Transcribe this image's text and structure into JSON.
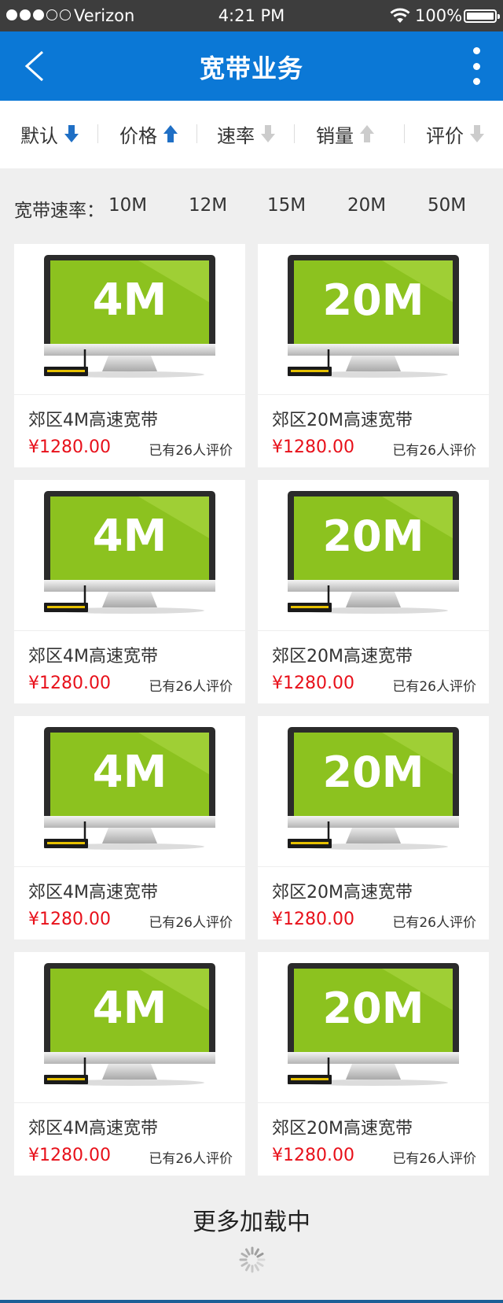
{
  "status_bar": {
    "carrier": "Verizon",
    "time": "4:21 PM",
    "battery": "100%",
    "signal_bars_filled": 3,
    "signal_bars_total": 5
  },
  "header": {
    "title": "宽带业务",
    "color": "#0b78d6"
  },
  "sort_bar": {
    "items": [
      {
        "label": "默认",
        "arrow": "down",
        "active": true
      },
      {
        "label": "价格",
        "arrow": "up",
        "active": true
      },
      {
        "label": "速率",
        "arrow": "down",
        "active": false
      },
      {
        "label": "销量",
        "arrow": "up",
        "active": false
      },
      {
        "label": "评价",
        "arrow": "down",
        "active": false
      }
    ]
  },
  "speed_filter": {
    "label": "宽带速率：",
    "options": [
      "10M",
      "12M",
      "15M",
      "20M",
      "50M"
    ]
  },
  "products": [
    {
      "screen_text": "4M",
      "name": "郊区4M高速宽带",
      "price": "¥1280.00",
      "reviews": "已有26人评价"
    },
    {
      "screen_text": "20M",
      "name": "郊区20M高速宽带",
      "price": "¥1280.00",
      "reviews": "已有26人评价"
    },
    {
      "screen_text": "4M",
      "name": "郊区4M高速宽带",
      "price": "¥1280.00",
      "reviews": "已有26人评价"
    },
    {
      "screen_text": "20M",
      "name": "郊区20M高速宽带",
      "price": "¥1280.00",
      "reviews": "已有26人评价"
    },
    {
      "screen_text": "4M",
      "name": "郊区4M高速宽带",
      "price": "¥1280.00",
      "reviews": "已有26人评价"
    },
    {
      "screen_text": "20M",
      "name": "郊区20M高速宽带",
      "price": "¥1280.00",
      "reviews": "已有26人评价"
    },
    {
      "screen_text": "4M",
      "name": "郊区4M高速宽带",
      "price": "¥1280.00",
      "reviews": "已有26人评价"
    },
    {
      "screen_text": "20M",
      "name": "郊区20M高速宽带",
      "price": "¥1280.00",
      "reviews": "已有26人评价"
    }
  ],
  "loading": {
    "text": "更多加载中"
  },
  "colors": {
    "accent_blue": "#0b78d6",
    "price_red": "#e8101a",
    "screen_green": "#8cc21f",
    "arrow_active": "#1f6fc5",
    "arrow_inactive": "#cccccc"
  }
}
